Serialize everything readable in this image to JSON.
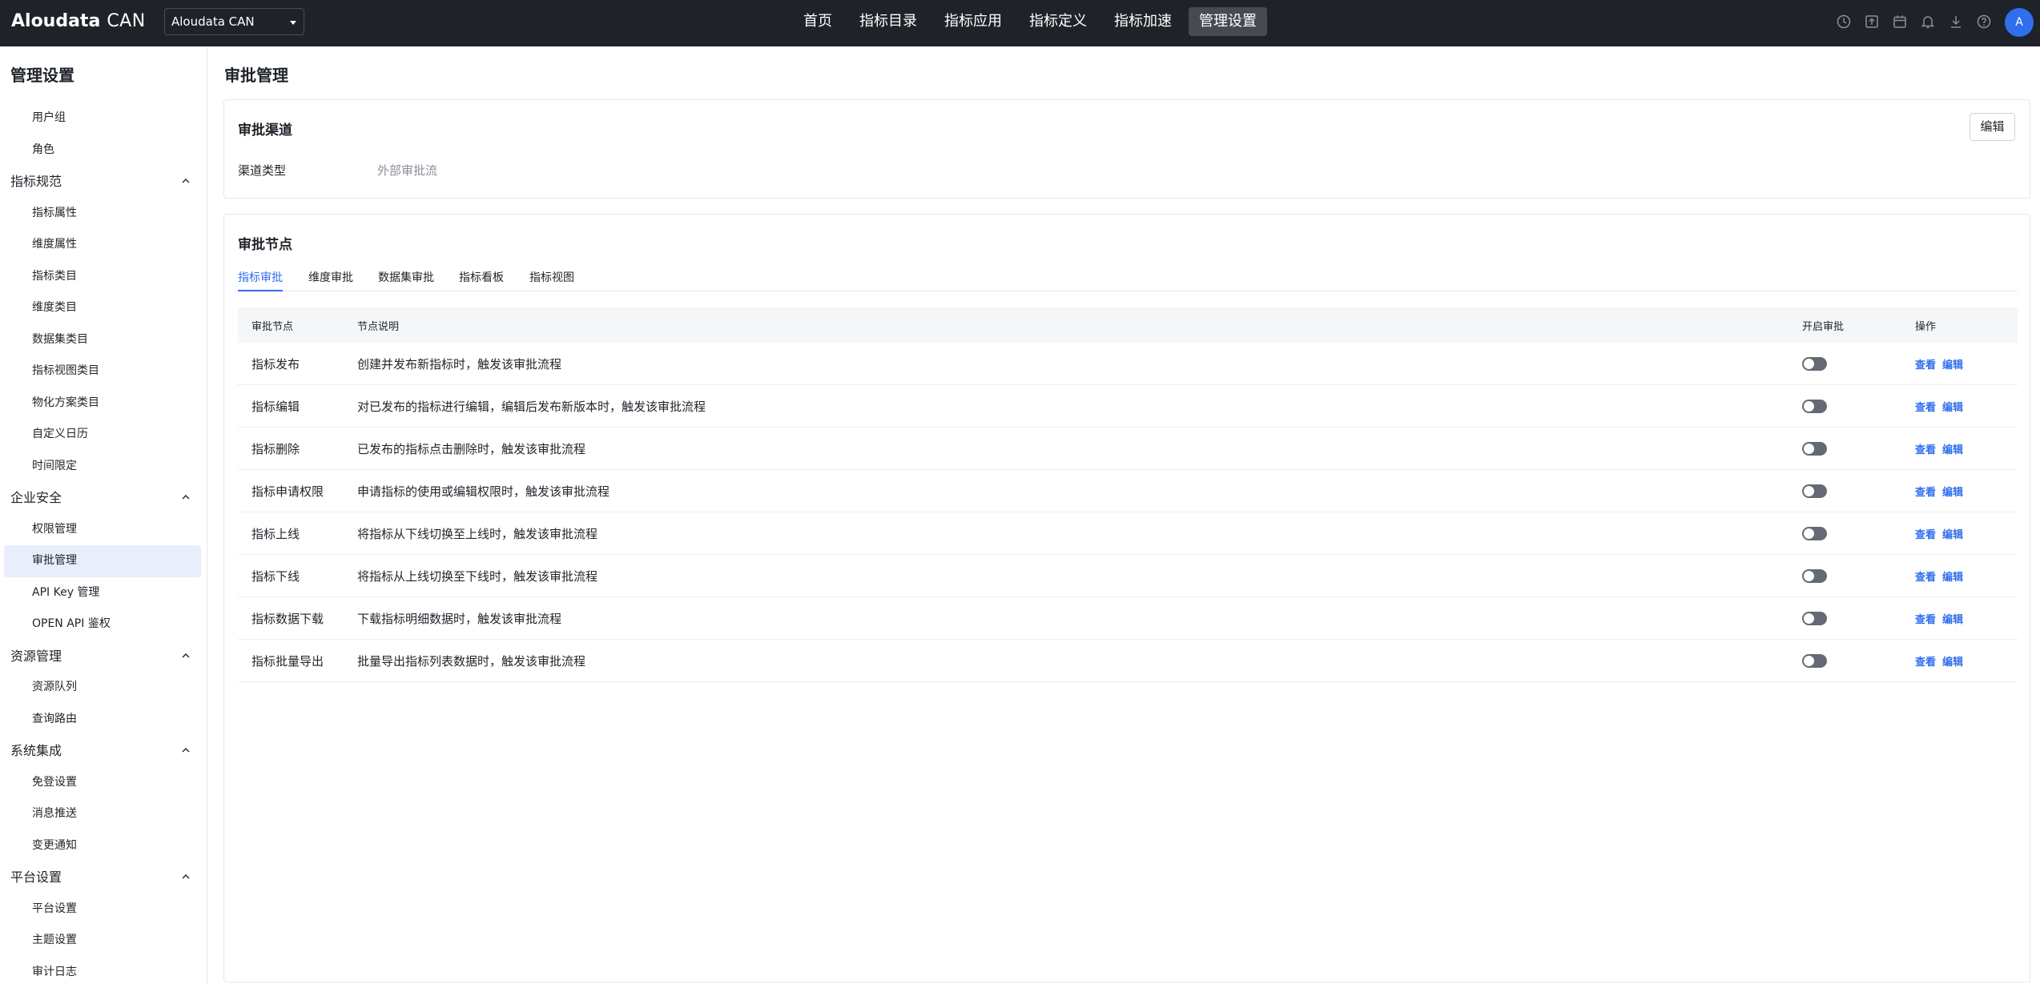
{
  "topbar": {
    "logo_main": "Aloudata",
    "logo_sub": "CAN",
    "project": "Aloudata CAN",
    "nav": [
      {
        "label": "首页",
        "active": false
      },
      {
        "label": "指标目录",
        "active": false
      },
      {
        "label": "指标应用",
        "active": false
      },
      {
        "label": "指标定义",
        "active": false
      },
      {
        "label": "指标加速",
        "active": false
      },
      {
        "label": "管理设置",
        "active": true
      }
    ],
    "icons": [
      "clock-icon",
      "export-icon",
      "calendar-icon",
      "bell-icon",
      "download-icon",
      "help-icon"
    ],
    "avatar": "A"
  },
  "sidebar": {
    "title": "管理设置",
    "entries": [
      {
        "type": "item",
        "label": "用户组"
      },
      {
        "type": "item",
        "label": "角色"
      },
      {
        "type": "group",
        "label": "指标规范"
      },
      {
        "type": "item",
        "label": "指标属性"
      },
      {
        "type": "item",
        "label": "维度属性"
      },
      {
        "type": "item",
        "label": "指标类目"
      },
      {
        "type": "item",
        "label": "维度类目"
      },
      {
        "type": "item",
        "label": "数据集类目"
      },
      {
        "type": "item",
        "label": "指标视图类目"
      },
      {
        "type": "item",
        "label": "物化方案类目"
      },
      {
        "type": "item",
        "label": "自定义日历"
      },
      {
        "type": "item",
        "label": "时间限定"
      },
      {
        "type": "group",
        "label": "企业安全"
      },
      {
        "type": "item",
        "label": "权限管理"
      },
      {
        "type": "item",
        "label": "审批管理",
        "active": true
      },
      {
        "type": "item",
        "label": "API Key 管理"
      },
      {
        "type": "item",
        "label": "OPEN API 鉴权"
      },
      {
        "type": "group",
        "label": "资源管理"
      },
      {
        "type": "item",
        "label": "资源队列"
      },
      {
        "type": "item",
        "label": "查询路由"
      },
      {
        "type": "group",
        "label": "系统集成"
      },
      {
        "type": "item",
        "label": "免登设置"
      },
      {
        "type": "item",
        "label": "消息推送"
      },
      {
        "type": "item",
        "label": "变更通知"
      },
      {
        "type": "group",
        "label": "平台设置"
      },
      {
        "type": "item",
        "label": "平台设置"
      },
      {
        "type": "item",
        "label": "主题设置"
      },
      {
        "type": "item",
        "label": "审计日志"
      }
    ]
  },
  "main": {
    "page_title": "审批管理",
    "channel": {
      "title": "审批渠道",
      "edit_label": "编辑",
      "field_label": "渠道类型",
      "field_value": "外部审批流"
    },
    "nodes": {
      "title": "审批节点",
      "tabs": [
        "指标审批",
        "维度审批",
        "数据集审批",
        "指标看板",
        "指标视图"
      ],
      "active_tab": 0,
      "columns": {
        "node": "审批节点",
        "desc": "节点说明",
        "enabled": "开启审批",
        "ops": "操作"
      },
      "view_label": "查看",
      "edit_label": "编辑",
      "rows": [
        {
          "node": "指标发布",
          "desc": "创建并发布新指标时，触发该审批流程",
          "enabled": false
        },
        {
          "node": "指标编辑",
          "desc": "对已发布的指标进行编辑，编辑后发布新版本时，触发该审批流程",
          "enabled": false
        },
        {
          "node": "指标删除",
          "desc": "已发布的指标点击删除时，触发该审批流程",
          "enabled": false
        },
        {
          "node": "指标申请权限",
          "desc": "申请指标的使用或编辑权限时，触发该审批流程",
          "enabled": false
        },
        {
          "node": "指标上线",
          "desc": "将指标从下线切换至上线时，触发该审批流程",
          "enabled": false
        },
        {
          "node": "指标下线",
          "desc": "将指标从上线切换至下线时，触发该审批流程",
          "enabled": false
        },
        {
          "node": "指标数据下载",
          "desc": "下载指标明细数据时，触发该审批流程",
          "enabled": false
        },
        {
          "node": "指标批量导出",
          "desc": "批量导出指标列表数据时，触发该审批流程",
          "enabled": false
        }
      ]
    }
  }
}
